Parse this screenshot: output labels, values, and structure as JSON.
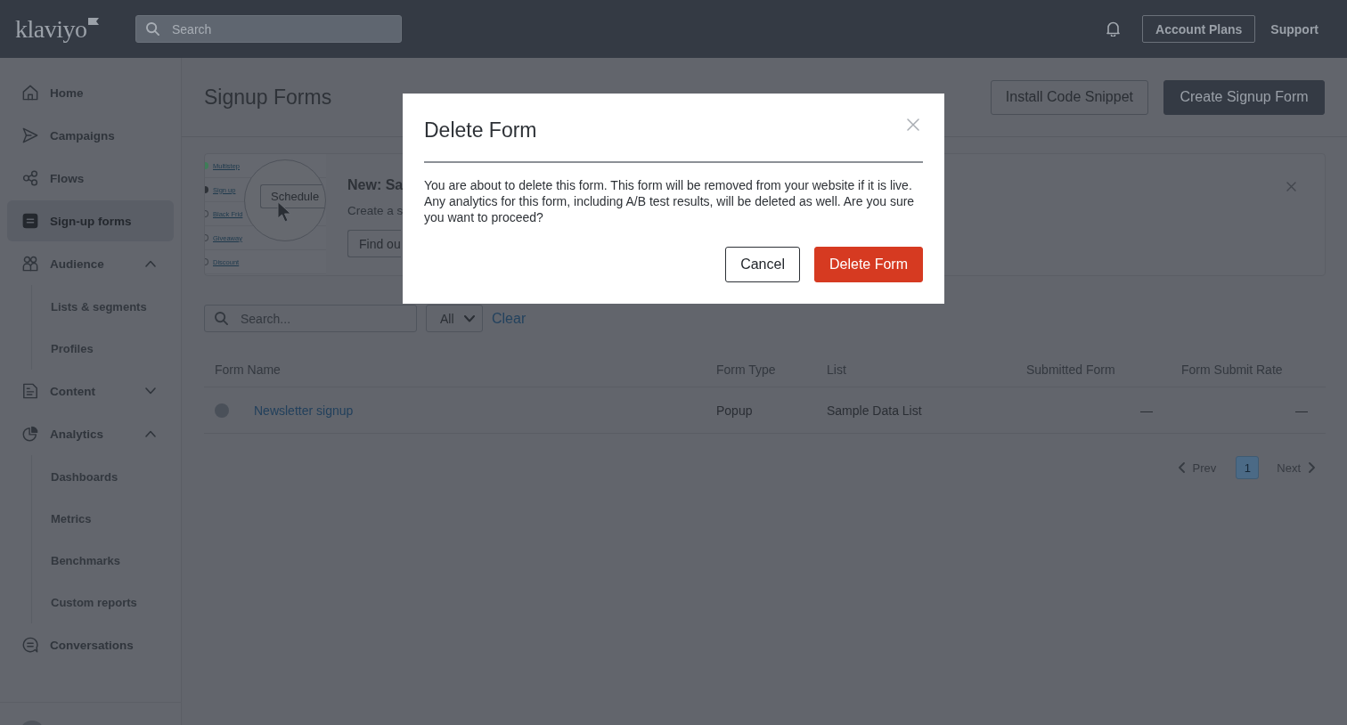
{
  "header": {
    "logo": "klaviyo",
    "search": {
      "placeholder": "Search"
    },
    "links": [
      {
        "label": "Account Plans",
        "kind": "outlined"
      },
      {
        "label": "Support",
        "kind": "plain"
      }
    ]
  },
  "sidebar": {
    "items": [
      {
        "label": "Home",
        "selected": false
      },
      {
        "label": "Campaigns",
        "selected": false
      },
      {
        "label": "Flows",
        "selected": false
      },
      {
        "label": "Sign-up forms",
        "selected": true
      },
      {
        "label": "Audience",
        "selected": false,
        "expanded": true,
        "children": [
          {
            "label": "Lists & segments",
            "selected": false
          },
          {
            "label": "Profiles",
            "selected": false
          }
        ]
      },
      {
        "label": "Content",
        "selected": false,
        "expanded": false
      },
      {
        "label": "Analytics",
        "selected": false,
        "expanded": true,
        "children": [
          {
            "label": "Dashboards",
            "selected": false
          },
          {
            "label": "Metrics",
            "selected": false
          },
          {
            "label": "Benchmarks",
            "selected": false
          },
          {
            "label": "Custom reports",
            "selected": false
          }
        ]
      },
      {
        "label": "Conversations",
        "selected": false
      }
    ]
  },
  "page": {
    "title": "Signup Forms",
    "actions": [
      {
        "label": "Install Code Snippet",
        "kind": "secondary"
      },
      {
        "label": "Create Signup Form",
        "kind": "primary"
      }
    ]
  },
  "banner": {
    "illustration": {
      "items": [
        {
          "label": "Multistep",
          "color": "#3f7d58"
        },
        {
          "label": "Sign up",
          "color": "#2e3238"
        },
        {
          "label": "Black Frid"
        },
        {
          "label": "Giveaway"
        },
        {
          "label": "Discount"
        }
      ],
      "button": "Schedule"
    },
    "title": "New: Sa",
    "text": "Create a s",
    "button": "Find ou"
  },
  "filters": {
    "search": {
      "placeholder": "Search..."
    },
    "type_filter": {
      "value": "All"
    },
    "clear": "Clear"
  },
  "table": {
    "columns": [
      "Form Name",
      "Form Type",
      "List",
      "Submitted Form",
      "Form Submit Rate"
    ],
    "rows": [
      {
        "cells": [
          "Newsletter signup",
          "Popup",
          "Sample Data List",
          "—",
          "—"
        ]
      }
    ]
  },
  "pagination": {
    "prev": {
      "label": "Prev",
      "disabled": true
    },
    "pages": [
      {
        "label": "1",
        "selected": true
      }
    ],
    "next": {
      "label": "Next",
      "disabled": true
    }
  },
  "dialog": {
    "title": "Delete Form",
    "message": "You are about to delete this form. This form will be removed from your website if it is live. Any analytics for this form, including A/B test results, will be deleted as well. Are you sure you want to proceed?",
    "buttons": [
      {
        "label": "Cancel",
        "kind": "secondary"
      },
      {
        "label": "Delete Form",
        "kind": "danger"
      }
    ]
  }
}
